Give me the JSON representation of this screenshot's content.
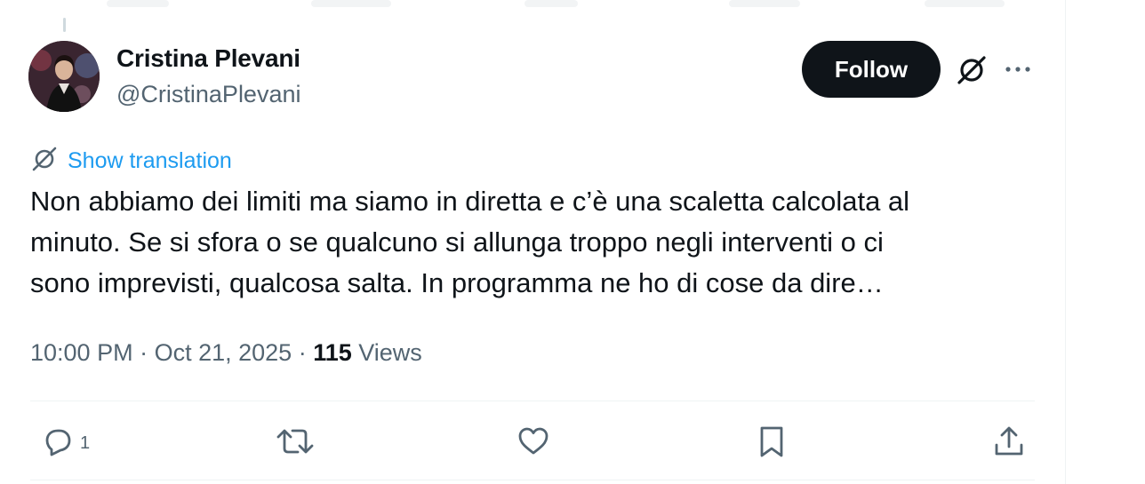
{
  "author": {
    "name": "Cristina Plevani",
    "handle": "@CristinaPlevani"
  },
  "header": {
    "follow_label": "Follow",
    "grok_icon": "grok-icon",
    "more_icon": "more-horizontal-icon"
  },
  "translation": {
    "label": "Show translation",
    "icon": "translate-icon"
  },
  "tweet": {
    "lines": [
      "Non abbiamo dei limiti ma siamo in diretta e c’è una scaletta calcolata al",
      "minuto. Se si sfora o se qualcuno si allunga troppo negli interventi o ci",
      "sono imprevisti, qualcosa salta. In programma ne ho di cose da dire…"
    ]
  },
  "meta": {
    "time": "10:00 PM",
    "separator": " · ",
    "date": "Oct 21, 2025",
    "views_count": "115",
    "views_label": " Views"
  },
  "actions": {
    "reply_count": "1",
    "reply_icon": "reply-icon",
    "repost_icon": "repost-icon",
    "like_icon": "like-icon",
    "bookmark_icon": "bookmark-icon",
    "share_icon": "share-icon"
  },
  "colors": {
    "text_primary": "#0f1419",
    "text_secondary": "#536471",
    "link": "#1d9bf0",
    "button_bg": "#0f1419",
    "divider": "#eff3f4"
  }
}
